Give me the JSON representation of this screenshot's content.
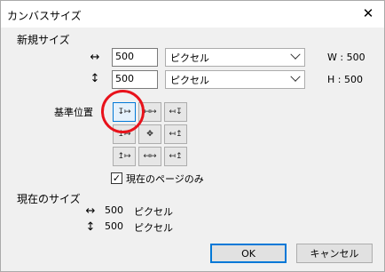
{
  "window": {
    "title": "カンバスサイズ",
    "close_glyph": "✕"
  },
  "new_size": {
    "section_label": "新規サイズ",
    "width": {
      "arrow_glyph": "↔",
      "value": "500",
      "unit": "ピクセル",
      "readout": "W : 500"
    },
    "height": {
      "arrow_glyph": "↕",
      "value": "500",
      "unit": "ピクセル",
      "readout": "H : 500"
    }
  },
  "anchor": {
    "label": "基準位置",
    "selected": "top-left",
    "cells": [
      {
        "id": "top-left",
        "glyph": "↧↦"
      },
      {
        "id": "top-center",
        "glyph": "↤↦"
      },
      {
        "id": "top-right",
        "glyph": "↤↧"
      },
      {
        "id": "middle-left",
        "glyph": "↥↦"
      },
      {
        "id": "center",
        "glyph": "✥"
      },
      {
        "id": "middle-right",
        "glyph": "↤↥"
      },
      {
        "id": "bottom-left",
        "glyph": "↥↦"
      },
      {
        "id": "bottom-center",
        "glyph": "↤↦"
      },
      {
        "id": "bottom-right",
        "glyph": "↤↥"
      }
    ],
    "highlight_color": "#e8121b"
  },
  "current_page_only": {
    "label": "現在のページのみ",
    "checked": true,
    "check_glyph": "✓"
  },
  "current_size": {
    "section_label": "現在のサイズ",
    "width": {
      "arrow_glyph": "↔",
      "value": "500",
      "unit": "ピクセル"
    },
    "height": {
      "arrow_glyph": "↕",
      "value": "500",
      "unit": "ピクセル"
    }
  },
  "buttons": {
    "ok": "OK",
    "cancel": "キャンセル"
  }
}
